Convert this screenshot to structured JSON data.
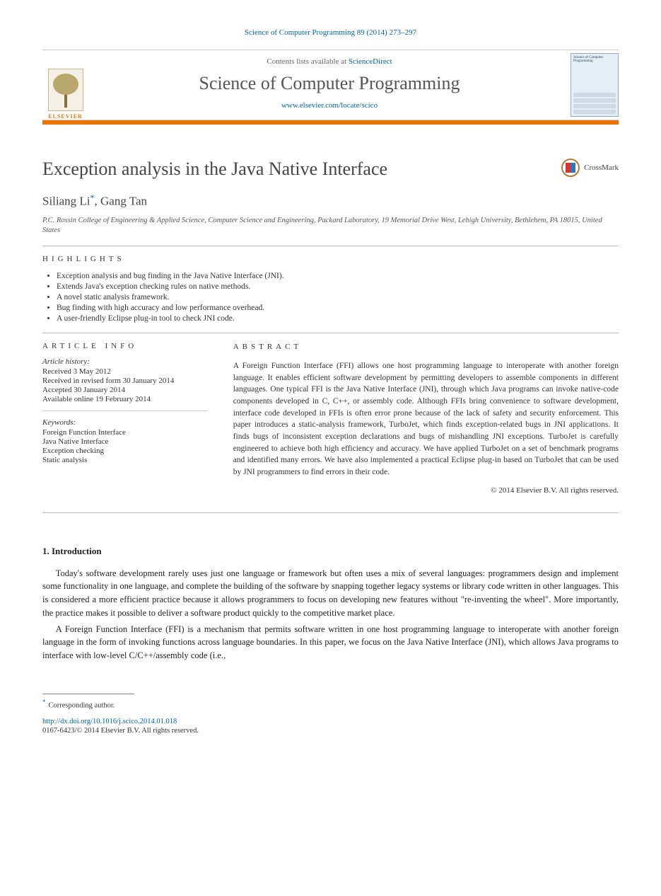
{
  "header": {
    "citation": "Science of Computer Programming 89 (2014) 273–297",
    "contents_prefix": "Contents lists available at ",
    "contents_link_text": "ScienceDirect",
    "journal_title": "Science of Computer Programming",
    "journal_link": "www.elsevier.com/locate/scico",
    "publisher": "ELSEVIER",
    "cover_caption": "Science of Computer Programming"
  },
  "article": {
    "title": "Exception analysis in the Java Native Interface",
    "crossmark_label": "CrossMark",
    "authors_html": "Siliang Li *, Gang Tan",
    "author1": "Siliang Li",
    "author2": "Gang Tan",
    "author_sep": ", ",
    "star": "*",
    "affiliation": "P.C. Rossin College of Engineering & Applied Science, Computer Science and Engineering, Packard Laboratory, 19 Memorial Drive West, Lehigh University, Bethlehem, PA 18015, United States"
  },
  "highlights": {
    "heading": "highlights",
    "items": [
      "Exception analysis and bug finding in the Java Native Interface (JNI).",
      "Extends Java's exception checking rules on native methods.",
      "A novel static analysis framework.",
      "Bug finding with high accuracy and low performance overhead.",
      "A user-friendly Eclipse plug-in tool to check JNI code."
    ]
  },
  "article_info": {
    "heading": "article info",
    "history_title": "Article history:",
    "history": [
      "Received 3 May 2012",
      "Received in revised form 30 January 2014",
      "Accepted 30 January 2014",
      "Available online 19 February 2014"
    ],
    "keywords_title": "Keywords:",
    "keywords": [
      "Foreign Function Interface",
      "Java Native Interface",
      "Exception checking",
      "Static analysis"
    ]
  },
  "abstract": {
    "heading": "abstract",
    "text": "A Foreign Function Interface (FFI) allows one host programming language to interoperate with another foreign language. It enables efficient software development by permitting developers to assemble components in different languages. One typical FFI is the Java Native Interface (JNI), through which Java programs can invoke native-code components developed in C, C++, or assembly code. Although FFIs bring convenience to software development, interface code developed in FFIs is often error prone because of the lack of safety and security enforcement. This paper introduces a static-analysis framework, TurboJet, which finds exception-related bugs in JNI applications. It finds bugs of inconsistent exception declarations and bugs of mishandling JNI exceptions. TurboJet is carefully engineered to achieve both high efficiency and accuracy. We have applied TurboJet on a set of benchmark programs and identified many errors. We have also implemented a practical Eclipse plug-in based on TurboJet that can be used by JNI programmers to find errors in their code.",
    "copyright": "© 2014 Elsevier B.V. All rights reserved."
  },
  "body": {
    "section_number": "1.",
    "section_title": "Introduction",
    "para1": "Today's software development rarely uses just one language or framework but often uses a mix of several languages: programmers design and implement some functionality in one language, and complete the building of the software by snapping together legacy systems or library code written in other languages. This is considered a more efficient practice because it allows programmers to focus on developing new features without \"re-inventing the wheel\". More importantly, the practice makes it possible to deliver a software product quickly to the competitive market place.",
    "para2": "A Foreign Function Interface (FFI) is a mechanism that permits software written in one host programming language to interoperate with another foreign language in the form of invoking functions across language boundaries. In this paper, we focus on the Java Native Interface (JNI), which allows Java programs to interface with low-level C/C++/assembly code (i.e.,"
  },
  "footer": {
    "corresponding": "Corresponding author.",
    "doi": "http://dx.doi.org/10.1016/j.scico.2014.01.018",
    "copyright": "0167-6423/© 2014 Elsevier B.V. All rights reserved."
  }
}
